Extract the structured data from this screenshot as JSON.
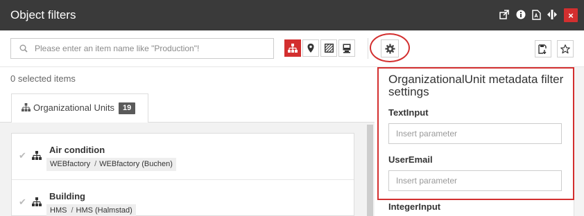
{
  "window": {
    "title": "Object filters",
    "header_icons": [
      "external-link-icon",
      "info-icon",
      "pdf-icon",
      "resize-vertical-icon"
    ],
    "close_label": "×"
  },
  "toolbar": {
    "search_placeholder": "Please enter an item name like \"Production\"!",
    "view_buttons": [
      "org-tree-icon",
      "location-pin-icon",
      "hatched-area-icon",
      "device-icon"
    ],
    "active_view": "org-tree-icon",
    "settings_icon": "gear-icon",
    "right_buttons": [
      "save-filter-icon",
      "star-icon"
    ]
  },
  "selection": {
    "count_text": "0 selected items"
  },
  "tabs": [
    {
      "label": "Organizational Units",
      "count": "19"
    }
  ],
  "items": [
    {
      "name": "Air condition",
      "path": [
        "WEBfactory",
        "WEBfactory (Buchen)"
      ]
    },
    {
      "name": "Building",
      "path": [
        "HMS",
        "HMS (Halmstad)"
      ]
    }
  ],
  "crumb_separator": "/",
  "settings_panel": {
    "title": "OrganizationalUnit metadata filter settings",
    "fields": [
      {
        "label": "TextInput",
        "placeholder": "Insert parameter",
        "value": ""
      },
      {
        "label": "UserEmail",
        "placeholder": "Insert parameter",
        "value": ""
      },
      {
        "label": "IntegerInput"
      }
    ]
  },
  "colors": {
    "header_bg": "#3a3a3a",
    "accent": "#d32f2f",
    "badge_bg": "#5a5a5a"
  }
}
